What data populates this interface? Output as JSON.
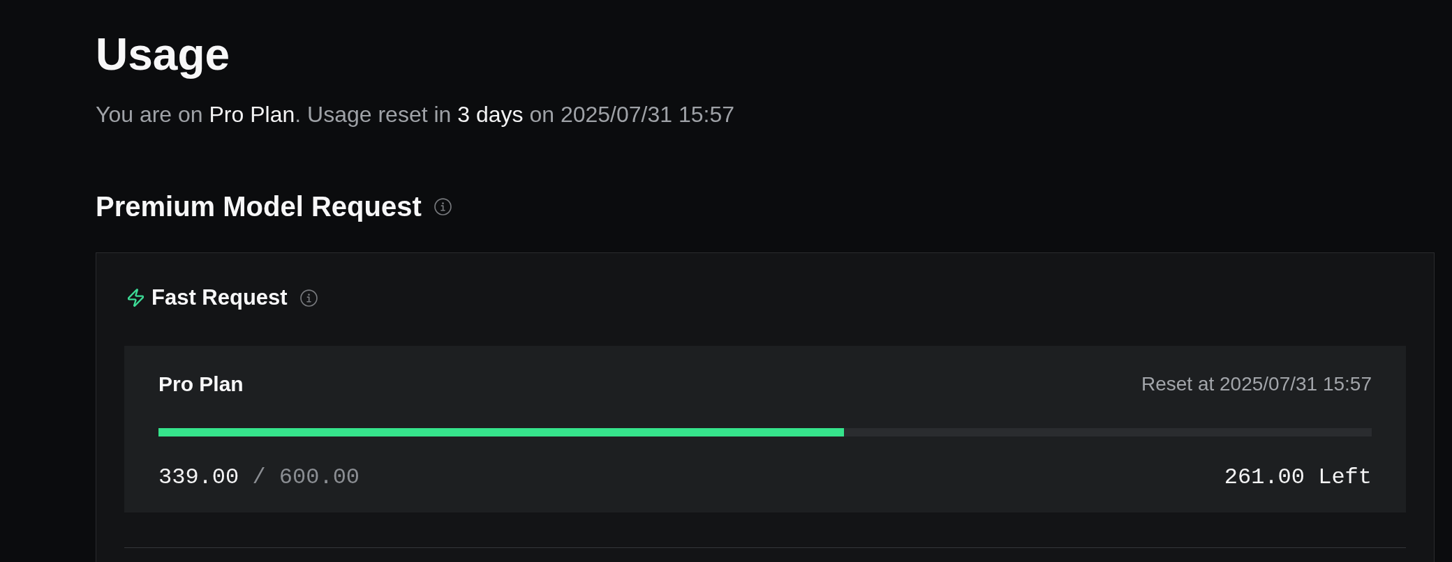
{
  "page": {
    "title": "Usage",
    "summary": "You are on **Pro Plan**. Usage reset in **3 days** on 2025/07/31 15:57"
  },
  "premium_section": {
    "title": "Premium Model Request",
    "groups": [
      {
        "title": "Fast Request",
        "plans": [
          {
            "name": "Pro Plan",
            "reset": "Reset at 2025/07/31 15:57",
            "level": 0.565,
            "usage": "**339.00** / 600.00",
            "remaining": "261.00 Left"
          }
        ]
      }
    ]
  }
}
